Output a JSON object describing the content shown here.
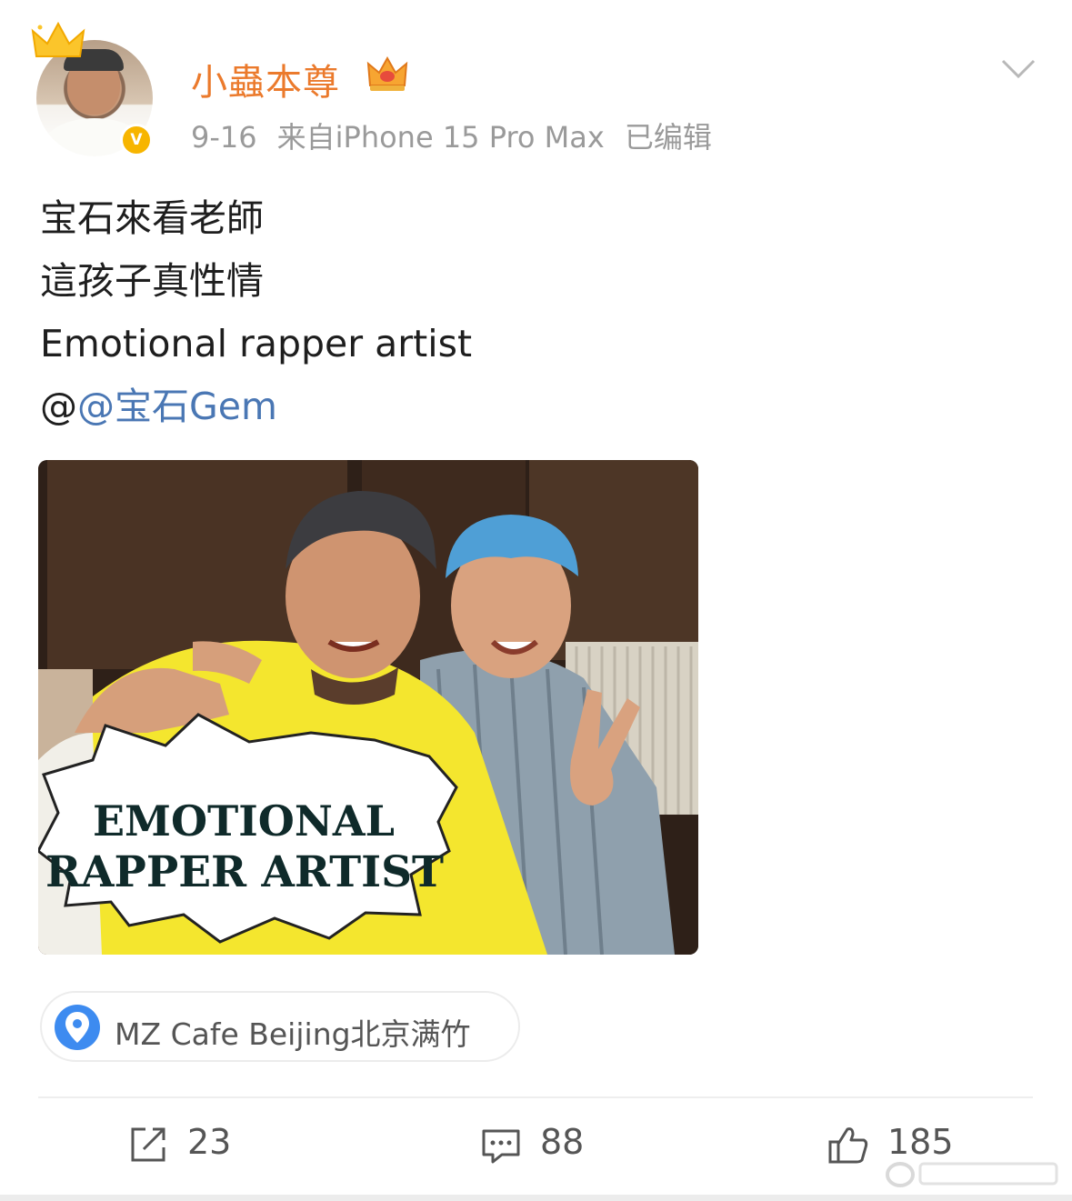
{
  "post": {
    "author": {
      "name": "小蟲本尊",
      "verified_badge": "V",
      "avatar_icon": "user-avatar",
      "vip_icon": "crown-icon"
    },
    "meta": {
      "date": "9-16",
      "source": "来自iPhone 15 Pro Max",
      "edited": "已编辑"
    },
    "text": {
      "line1": "宝石來看老師",
      "line2": "這孩子真性情",
      "line3": "Emotional rapper artist",
      "mention_prefix": "@",
      "mention": "@宝石Gem"
    },
    "photo": {
      "caption_line1": "EMOTIONAL",
      "caption_line2": "RAPPER ARTIST"
    },
    "location": {
      "icon": "map-pin-icon",
      "label": "MZ Cafe Beijing北京满竹"
    },
    "actions": {
      "repost_count": "23",
      "comment_count": "88",
      "like_count": "185"
    }
  },
  "colors": {
    "username": "#eb7a2c",
    "mention": "#4a77b4",
    "meta": "#9a9a9a",
    "location_icon": "#3d8bf0",
    "verified_badge": "#f7b500"
  }
}
